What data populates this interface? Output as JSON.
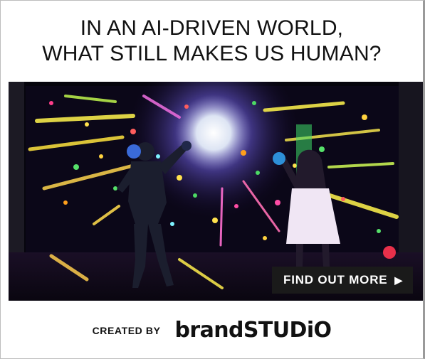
{
  "ad": {
    "headline_line1": "IN AN AI-DRIVEN WORLD,",
    "headline_line2": "WHAT STILL MAKES US HUMAN?",
    "cta_label": "FIND OUT MORE",
    "cta_icon": "play-arrow-icon",
    "created_by": "CREATED BY",
    "brand_part1": "brand",
    "brand_part2": "STUDiO"
  },
  "colors": {
    "text": "#111111",
    "cta_background": "#1a1a1a",
    "cta_text": "#ffffff",
    "scene_background": "#05040c"
  }
}
